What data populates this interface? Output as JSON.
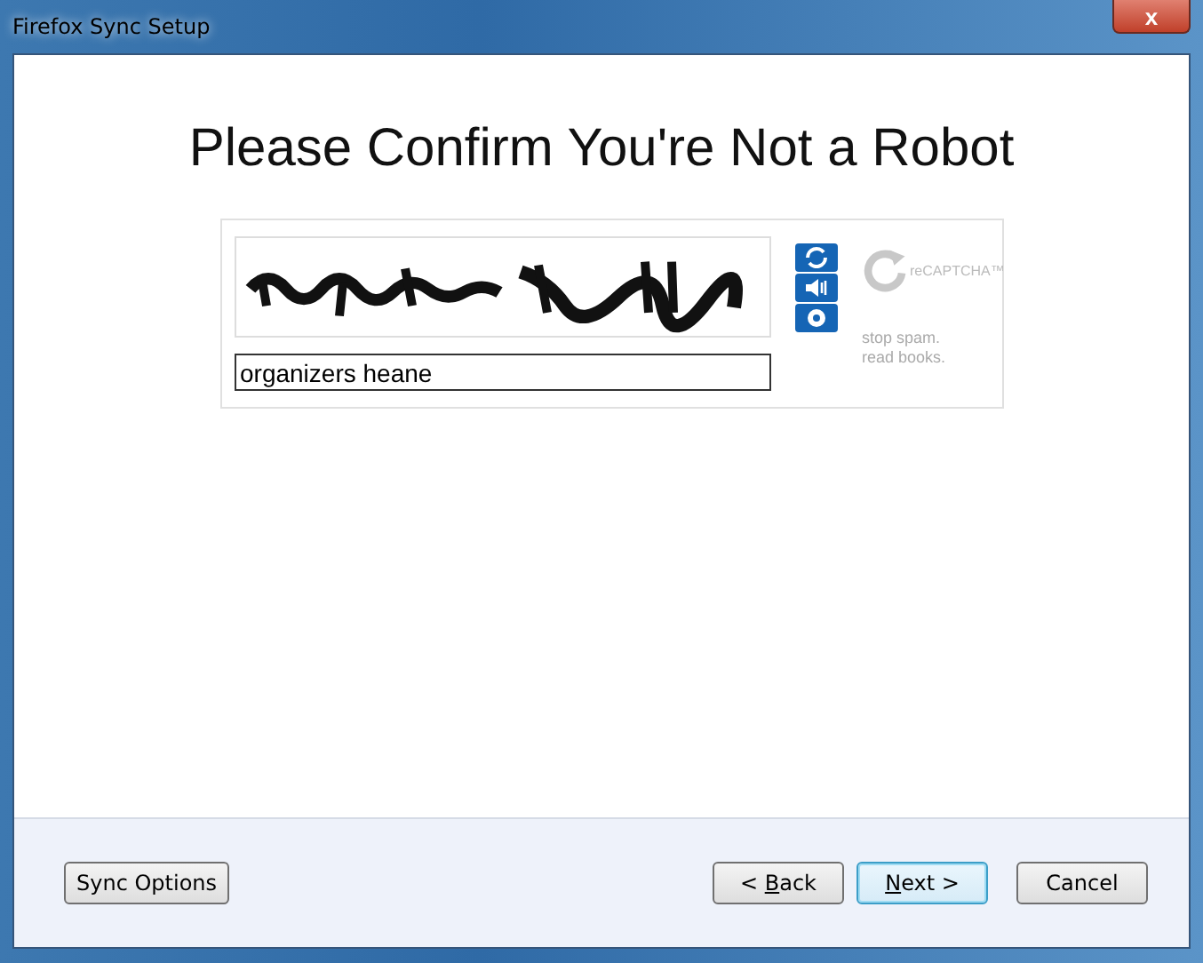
{
  "window": {
    "title": "Firefox Sync Setup",
    "close_label": "x"
  },
  "heading": "Please Confirm You're Not a Robot",
  "captcha": {
    "answer": "organizers heane",
    "logo": "reCAPTCHA™",
    "slogan": "stop spam. read books."
  },
  "footer": {
    "left_buttons": [
      {
        "label": {
          "post": "Sync Options"
        },
        "default": false
      }
    ],
    "right_buttons": [
      {
        "label": {
          "pre": "< ",
          "key": "B",
          "post": "ack"
        },
        "default": false
      },
      {
        "label": {
          "key": "N",
          "post": "ext >"
        },
        "default": true
      },
      {
        "label": {
          "post": "Cancel"
        },
        "default": false
      }
    ]
  }
}
